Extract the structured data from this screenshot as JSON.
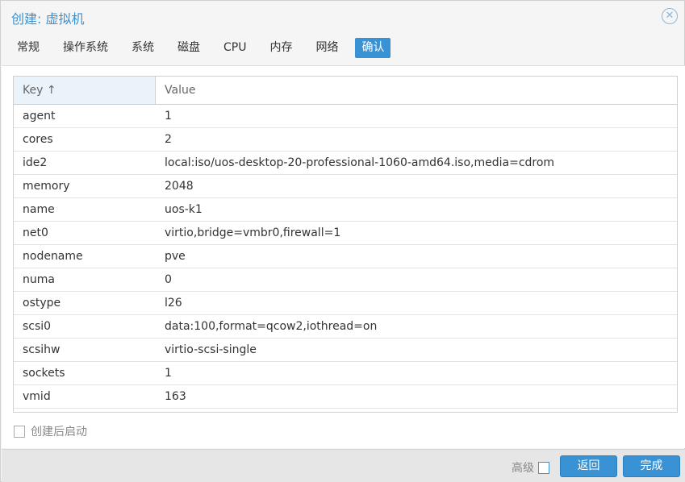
{
  "window": {
    "title": "创建: 虚拟机"
  },
  "tabs": [
    {
      "label": "常规"
    },
    {
      "label": "操作系统"
    },
    {
      "label": "系统"
    },
    {
      "label": "磁盘"
    },
    {
      "label": "CPU"
    },
    {
      "label": "内存"
    },
    {
      "label": "网络"
    },
    {
      "label": "确认",
      "active": true
    }
  ],
  "table": {
    "columns": [
      "Key ↑",
      "Value"
    ],
    "rows": [
      [
        "agent",
        "1"
      ],
      [
        "cores",
        "2"
      ],
      [
        "ide2",
        "local:iso/uos-desktop-20-professional-1060-amd64.iso,media=cdrom"
      ],
      [
        "memory",
        "2048"
      ],
      [
        "name",
        "uos-k1"
      ],
      [
        "net0",
        "virtio,bridge=vmbr0,firewall=1"
      ],
      [
        "nodename",
        "pve"
      ],
      [
        "numa",
        "0"
      ],
      [
        "ostype",
        "l26"
      ],
      [
        "scsi0",
        "data:100,format=qcow2,iothread=on"
      ],
      [
        "scsihw",
        "virtio-scsi-single"
      ],
      [
        "sockets",
        "1"
      ],
      [
        "vmid",
        "163"
      ]
    ]
  },
  "start_after_create": {
    "label": "创建后启动",
    "checked": false
  },
  "footer": {
    "advanced_label": "高级",
    "advanced_checked": false,
    "back_label": "返回",
    "finish_label": "完成"
  },
  "colors": {
    "accent": "#3892d4"
  }
}
